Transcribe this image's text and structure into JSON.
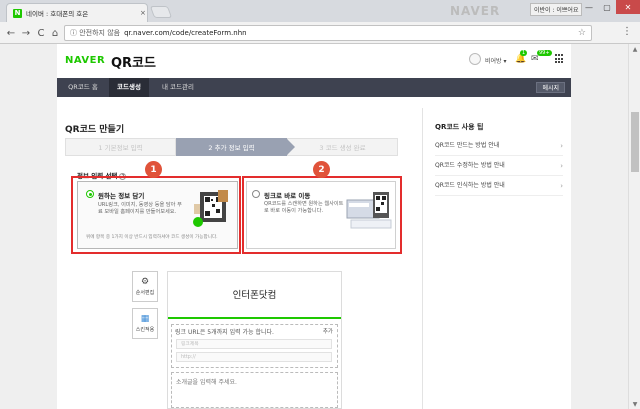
{
  "browser": {
    "tab_title": "네이버 : 호대폰의 호은",
    "tab_close": "×",
    "watermark": "NAVER",
    "user_badge": "이반이 : 이쁘어요",
    "win_minimize": "—",
    "win_maximize": "▢",
    "win_close": "✕",
    "security": "ⓘ 안전하지 않음",
    "url": "qr.naver.com/code/createForm.nhn",
    "back": "←",
    "forward": "→",
    "reload": "C",
    "home": "⌂",
    "star": "☆",
    "menu": "⋮"
  },
  "header": {
    "logo": "NAVER",
    "service": "QR코드",
    "user_name": "비어방 ▾",
    "bell_count": "1",
    "mail_count": "99+"
  },
  "menu": {
    "items": [
      "QR코드 홈",
      "코드생성",
      "내 코드관리"
    ],
    "message": "메시지"
  },
  "page": {
    "heading": "QR코드 만들기",
    "steps": [
      "1 기본정보 입력",
      "2 추가 정보 입력",
      "3 코드 생성 완료"
    ]
  },
  "section": {
    "label": "정보 입력 선택",
    "help": "?"
  },
  "options": [
    {
      "title": "원하는 정보 담기",
      "desc": "URL링크, 이미지, 동영상 등을 담아 무료 모바일 홈페이지를 만들어보세요.",
      "note": "위에 항목 중 1가지 이상 반드시 입력하셔야 코드 생성이 가능합니다."
    },
    {
      "title": "링크로 바로 이동",
      "desc": "QR코드를 스캔하면 원하는 웹사이트로 바로 이동이 가능합니다."
    }
  ],
  "badges": [
    "1",
    "2"
  ],
  "tools": [
    {
      "icon": "⚙",
      "label": "순서편집"
    },
    {
      "icon": "▦",
      "label": "스킨적용"
    }
  ],
  "editor": {
    "title": "인터폰닷컴",
    "link_head": "링크 URL은 5개까지 입력 가능 합니다.",
    "link_add": "추가",
    "link_title_placeholder": "링크제목",
    "link_url_placeholder": "http://",
    "desc_placeholder": "소개글을 입력해 주세요."
  },
  "tips": {
    "title": "QR코드 사용 팁",
    "items": [
      "QR코드 만드는 방법 안내",
      "QR코드 수정하는 방법 안내",
      "QR코드 인식하는 방법 안내"
    ],
    "arrow": "›"
  },
  "colors": {
    "naver_green": "#1ec800",
    "menubar": "#3e4250",
    "active_step": "#99a1b2",
    "highlight_red": "#e32d2d",
    "badge_orange": "#e0533a"
  }
}
